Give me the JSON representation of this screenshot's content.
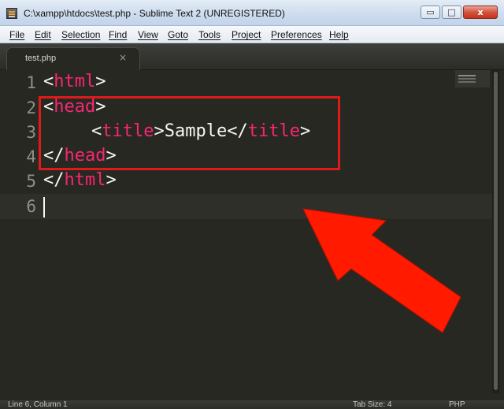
{
  "window": {
    "title": "C:\\xampp\\htdocs\\test.php - Sublime Text 2 (UNREGISTERED)",
    "controls": {
      "minimize": "▭",
      "maximize": "□",
      "close": "x"
    }
  },
  "menu": [
    "File",
    "Edit",
    "Selection",
    "Find",
    "View",
    "Goto",
    "Tools",
    "Project",
    "Preferences",
    "Help"
  ],
  "tab": {
    "label": "test.php",
    "close": "×"
  },
  "editor": {
    "line_numbers": [
      "1",
      "2",
      "3",
      "4",
      "5",
      "6"
    ],
    "lines": [
      {
        "lt": "<",
        "tag": "html",
        "gt": ">",
        "inner": "",
        "lt2": "",
        "tag2": "",
        "gt2": ""
      },
      {
        "lt": "<",
        "tag": "head",
        "gt": ">",
        "inner": "",
        "lt2": "",
        "tag2": "",
        "gt2": ""
      },
      {
        "lt": "<",
        "tag": "title",
        "gt": ">",
        "inner": "Sample",
        "lt2": "</",
        "tag2": "title",
        "gt2": ">"
      },
      {
        "lt": "</",
        "tag": "head",
        "gt": ">",
        "inner": "",
        "lt2": "",
        "tag2": "",
        "gt2": ""
      },
      {
        "lt": "</",
        "tag": "html",
        "gt": ">",
        "inner": "",
        "lt2": "",
        "tag2": "",
        "gt2": ""
      }
    ],
    "current_line": "6"
  },
  "colors": {
    "tag": "#f92672",
    "text": "#f8f8f2",
    "background": "#272822",
    "annotation": "#ff1a00"
  },
  "status": {
    "position": "Line 6, Column 1",
    "tab_size": "Tab Size: 4",
    "syntax": "PHP"
  }
}
